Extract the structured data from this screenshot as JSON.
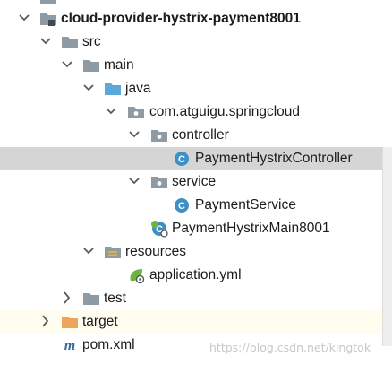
{
  "tree": {
    "module": "cloud-provider-hystrix-payment8001",
    "src": "src",
    "main": "main",
    "java": "java",
    "package": "com.atguigu.springcloud",
    "controller": "controller",
    "controller_class": "PaymentHystrixController",
    "service": "service",
    "service_class": "PaymentService",
    "main_class": "PaymentHystrixMain8001",
    "resources": "resources",
    "application_yml": "application.yml",
    "test": "test",
    "target": "target",
    "pom": "pom.xml"
  },
  "watermark": "https://blog.csdn.net/kingtok",
  "icons": {
    "module": "module-folder-icon",
    "folder": "folder-icon",
    "source_root": "source-root-folder-icon",
    "package": "package-icon",
    "class": "class-icon",
    "main_class": "spring-boot-main-class-icon",
    "resources": "resources-root-folder-icon",
    "yml": "spring-yml-file-icon",
    "excluded": "excluded-folder-icon",
    "maven": "maven-pom-icon"
  },
  "colors": {
    "selection": "#d5d5d5",
    "folder": "#8e9aa4",
    "source_root": "#5aa9d8",
    "class": "#3d8fc4",
    "excluded": "#f0a35a",
    "spring": "#6db33f",
    "maven": "#2f6ca0"
  }
}
